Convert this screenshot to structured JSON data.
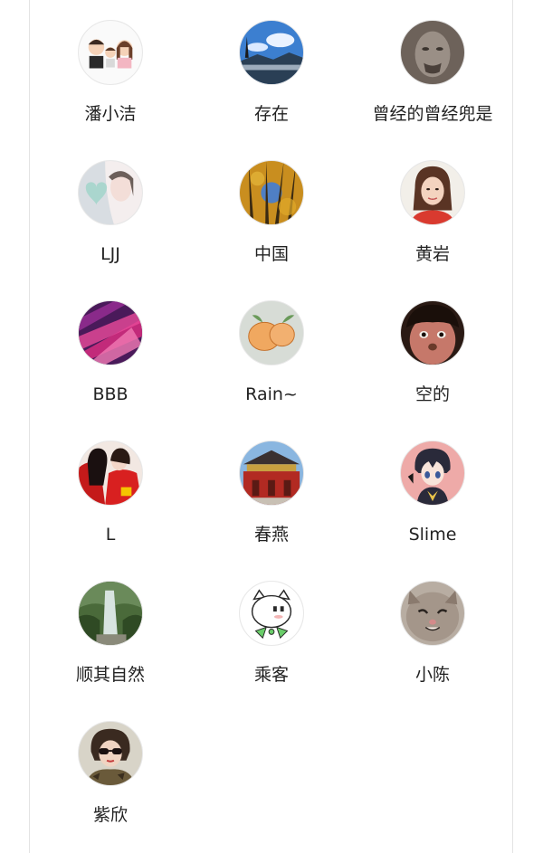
{
  "members": [
    {
      "name": "潘小洁",
      "avatar": "family-cartoon-avatar"
    },
    {
      "name": "存在",
      "avatar": "sky-clouds-avatar"
    },
    {
      "name": "曾经的曾经兜是",
      "avatar": "stone-face-avatar"
    },
    {
      "name": "LJJ",
      "avatar": "girl-heart-avatar"
    },
    {
      "name": "中国",
      "avatar": "autumn-trees-avatar"
    },
    {
      "name": "黄岩",
      "avatar": "woman-portrait-avatar"
    },
    {
      "name": "BBB",
      "avatar": "pink-feathers-avatar"
    },
    {
      "name": "Rain~",
      "avatar": "oranges-drawing-avatar"
    },
    {
      "name": "空的",
      "avatar": "child-face-avatar"
    },
    {
      "name": "L",
      "avatar": "red-couple-avatar"
    },
    {
      "name": "春燕",
      "avatar": "gate-building-avatar"
    },
    {
      "name": "Slime",
      "avatar": "anime-boy-avatar"
    },
    {
      "name": "顺其自然",
      "avatar": "waterfall-avatar"
    },
    {
      "name": "乘客",
      "avatar": "cartoon-cat-avatar"
    },
    {
      "name": "小陈",
      "avatar": "cat-face-avatar"
    },
    {
      "name": "紫欣",
      "avatar": "sunglasses-woman-avatar"
    }
  ]
}
